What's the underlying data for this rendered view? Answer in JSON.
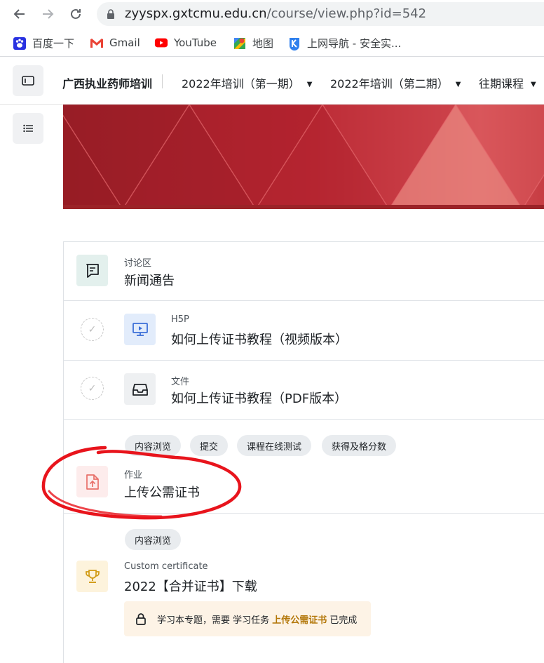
{
  "browser": {
    "url_host": "zyyspx.gxtcmu.edu.cn",
    "url_path": "/course/view.php?id=542",
    "bookmarks": [
      {
        "label": "百度一下",
        "icon": "baidu-paw-icon"
      },
      {
        "label": "Gmail",
        "icon": "gmail-icon"
      },
      {
        "label": "YouTube",
        "icon": "youtube-icon"
      },
      {
        "label": "地图",
        "icon": "maps-icon"
      },
      {
        "label": "上网导航 - 安全实...",
        "icon": "navigation-k-icon"
      }
    ]
  },
  "navbar": {
    "site_name": "广西执业药师培训",
    "items": [
      {
        "label": "2022年培训（第一期）"
      },
      {
        "label": "2022年培训（第二期）"
      },
      {
        "label": "往期课程"
      }
    ]
  },
  "activities": [
    {
      "type": "讨论区",
      "title": "新闻通告",
      "icon": "forum-icon",
      "color": "#e3f0ed"
    },
    {
      "type": "H5P",
      "title": "如何上传证书教程（视频版本）",
      "icon": "h5p-icon",
      "color": "#e2ecfb"
    },
    {
      "type": "文件",
      "title": "如何上传证书教程（PDF版本）",
      "icon": "file-icon",
      "color": "#eef0f2"
    },
    {
      "type": "作业",
      "title": "上传公需证书",
      "icon": "assignment-upload-icon",
      "color": "#fdecec",
      "tags": [
        "内容浏览",
        "提交",
        "课程在线测试",
        "获得及格分数"
      ]
    },
    {
      "type": "Custom certificate",
      "title": "2022【合并证书】下载",
      "icon": "trophy-icon",
      "color": "#fdf3dc",
      "tags": [
        "内容浏览"
      ]
    }
  ],
  "restriction": {
    "prefix": "学习本专题，需要 学习任务 ",
    "link": "上传公需证书",
    "suffix": " 已完成"
  },
  "colors": {
    "banner_red": "#a8202a",
    "annotation_red": "#e8141c",
    "restriction_link": "#b37708"
  }
}
